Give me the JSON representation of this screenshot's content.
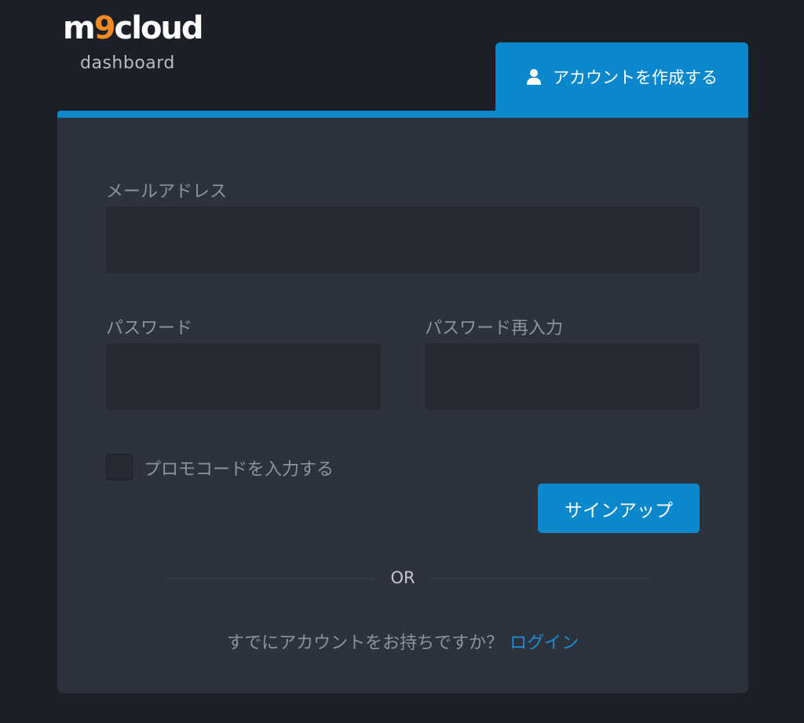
{
  "brand": {
    "logo_m": "m",
    "logo_9": "9",
    "logo_cloud": "cloud",
    "subtitle": "dashboard",
    "accent_color": "#0a88cb",
    "logo_orange": "#f08a24"
  },
  "tab": {
    "label": "アカウントを作成する",
    "icon": "user-icon"
  },
  "form": {
    "email_label": "メールアドレス",
    "email_value": "",
    "password_label": "パスワード",
    "password_value": "",
    "password_confirm_label": "パスワード再入力",
    "password_confirm_value": "",
    "promo_label": "プロモコードを入力する",
    "promo_checked": false,
    "submit_label": "サインアップ"
  },
  "divider": {
    "text": "OR"
  },
  "footer": {
    "prompt": "すでにアカウントをお持ちですか？",
    "login_link": "ログイン"
  }
}
